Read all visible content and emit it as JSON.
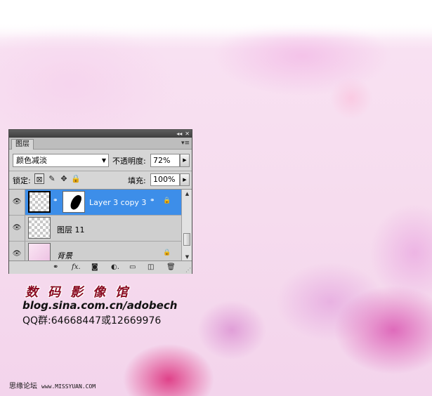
{
  "panel": {
    "titlebar_icons": [
      "collapse-icon",
      "close-icon"
    ],
    "collapse_glyph": "◂◂",
    "close_glyph": "✕",
    "tab_label": "图层",
    "menu_glyph": "▾≡",
    "blend_mode": "颜色减淡",
    "opacity_label": "不透明度:",
    "opacity_value": "72%",
    "lock_label": "锁定:",
    "fill_label": "填充:",
    "fill_value": "100%",
    "layers": [
      {
        "name": "Layer 3 copy 3",
        "selected": true,
        "visible": true
      },
      {
        "name": "图层 11",
        "selected": false,
        "visible": true
      },
      {
        "name": "背景",
        "selected": false,
        "visible": true,
        "locked": true
      }
    ]
  },
  "watermark": {
    "brand": "数码影像馆",
    "blog": "blog.sina.com.cn/adobech",
    "qq": "QQ群:64668447或12669976",
    "forum": "思缘论坛",
    "forum_url": "www.MISSYUAN.COM"
  }
}
